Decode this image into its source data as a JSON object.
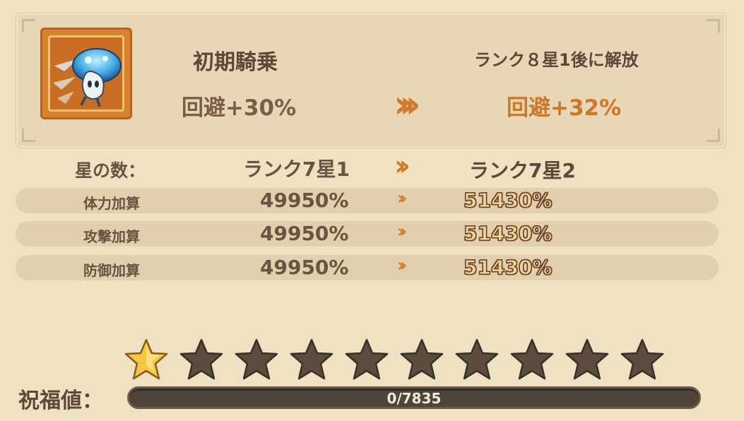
{
  "skill": {
    "name": "初期騎乗",
    "current_effect": "回避+30%",
    "unlock_note": "ランク８星1後に解放",
    "next_effect": "回避+32%",
    "arrow": "»"
  },
  "rank": {
    "label": "星の数：",
    "current": "ランク7星1",
    "next": "ランク7星2",
    "arrow": "»"
  },
  "stats": [
    {
      "label": "体力加算",
      "current": "49950%",
      "next": "51430%",
      "arrow": "»"
    },
    {
      "label": "攻撃加算",
      "current": "49950%",
      "next": "51430%",
      "arrow": "»"
    },
    {
      "label": "防御加算",
      "current": "49950%",
      "next": "51430%",
      "arrow": "»"
    }
  ],
  "stars": {
    "filled": 1,
    "total": 10,
    "filled_color": "#f5c843",
    "empty_color": "#5b4c3e",
    "icon": "star-icon"
  },
  "blessing": {
    "label": "祝福値：",
    "text": "0/7835",
    "progress": 0
  },
  "colors": {
    "background": "#efe2c2",
    "accent": "#cf7b2a",
    "text": "#5c4738"
  }
}
